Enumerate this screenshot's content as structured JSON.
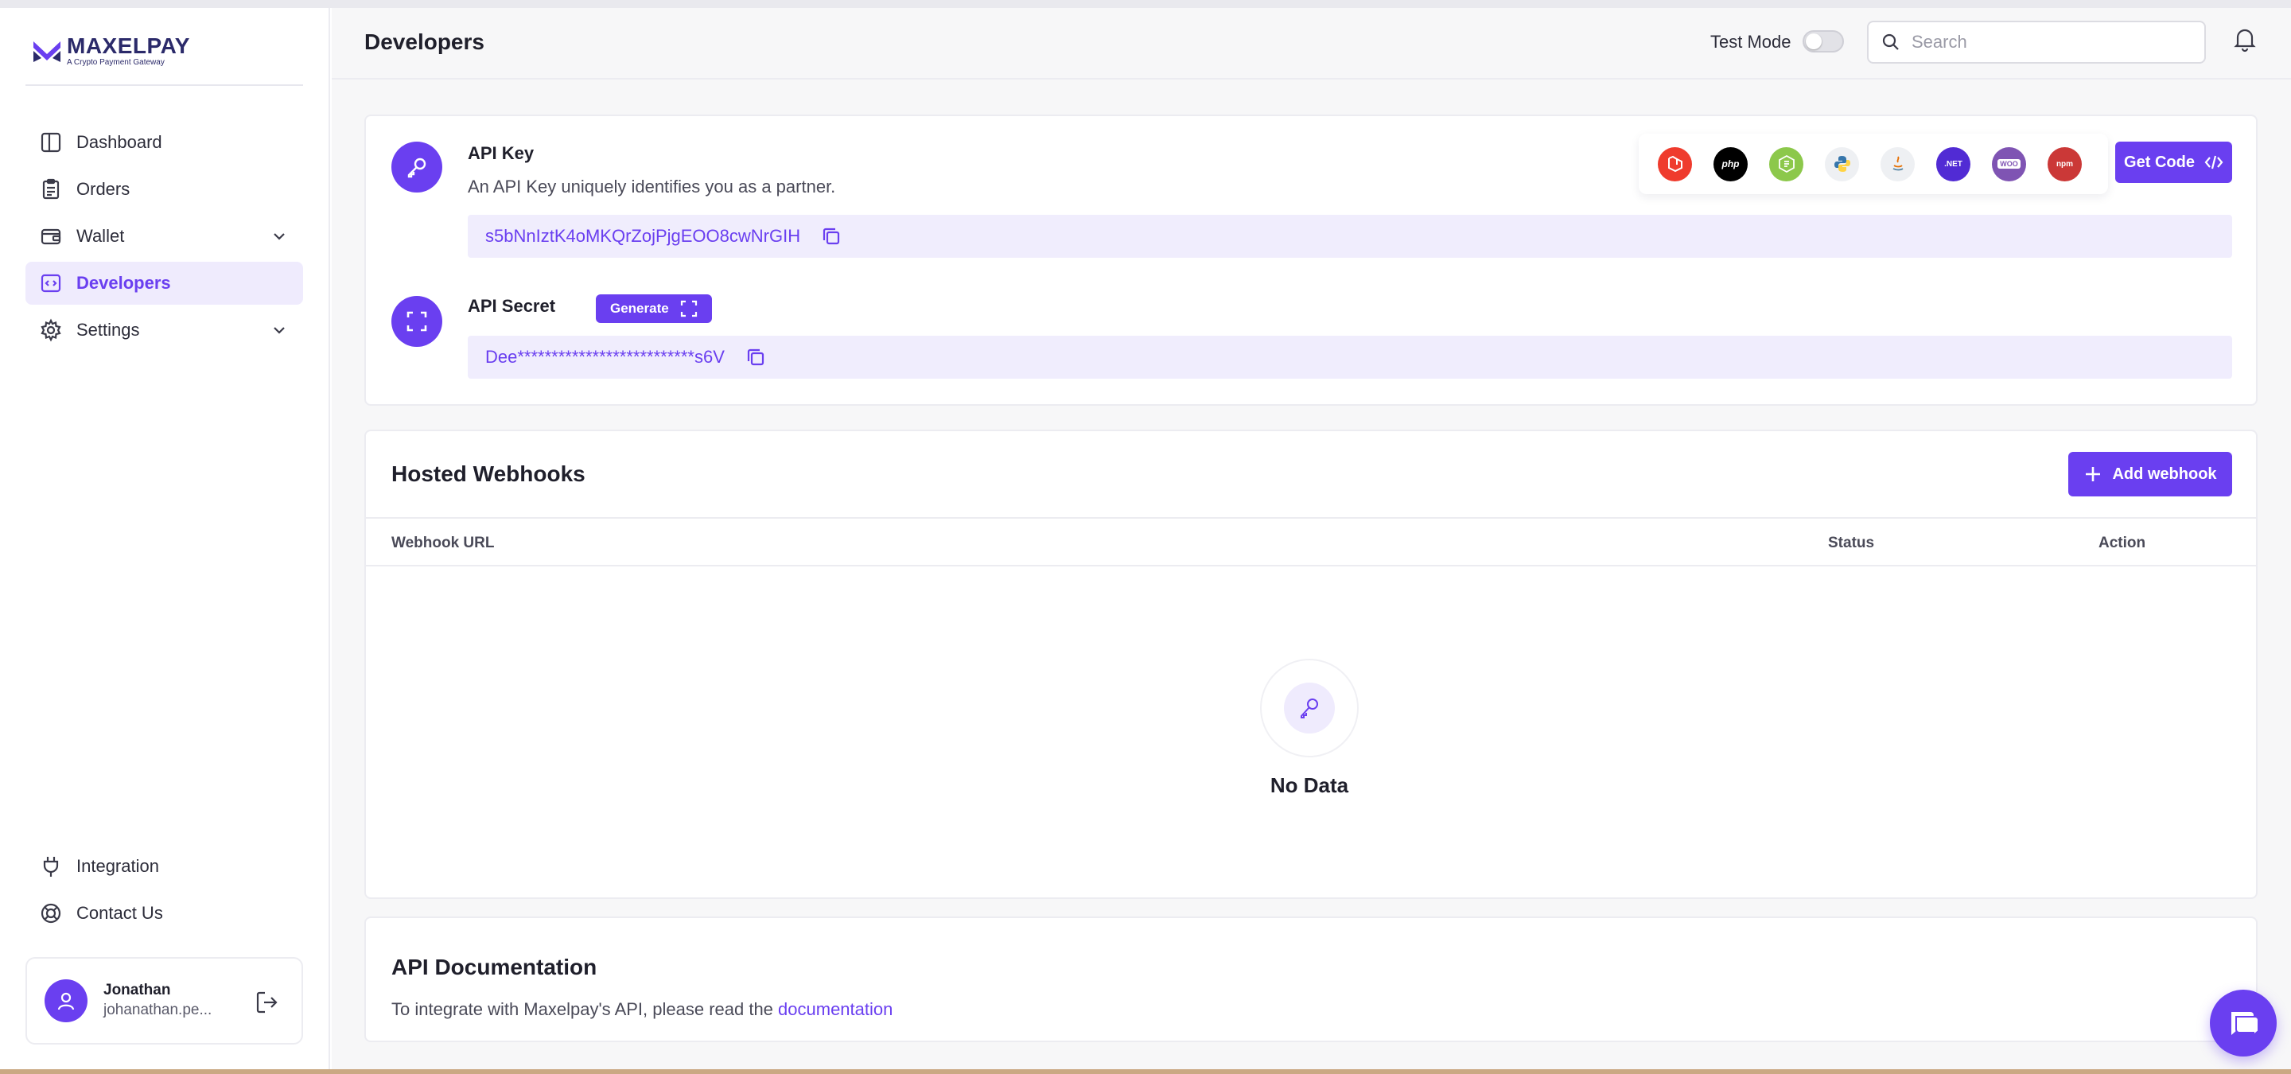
{
  "brand": {
    "name": "MAXELPAY",
    "tagline": "A Crypto Payment Gateway",
    "accent_color": "#6a3ff0"
  },
  "sidebar": {
    "items": [
      {
        "label": "Dashboard",
        "icon": "layout-icon"
      },
      {
        "label": "Orders",
        "icon": "clipboard-icon"
      },
      {
        "label": "Wallet",
        "icon": "wallet-icon",
        "has_submenu": true
      },
      {
        "label": "Developers",
        "icon": "code-icon",
        "active": true
      },
      {
        "label": "Settings",
        "icon": "gear-icon",
        "has_submenu": true
      }
    ],
    "bottom_items": [
      {
        "label": "Integration",
        "icon": "plug-icon"
      },
      {
        "label": "Contact Us",
        "icon": "lifebuoy-icon"
      }
    ],
    "user": {
      "name": "Jonathan",
      "email": "johanathan.pe..."
    }
  },
  "header": {
    "title": "Developers",
    "test_mode_label": "Test Mode",
    "test_mode_on": false,
    "search_placeholder": "Search"
  },
  "api": {
    "key_title": "API Key",
    "key_description": "An API Key uniquely identifies you as a partner.",
    "key_value": "s5bNnIztK4oMKQrZojPjgEOO8cwNrGIH",
    "secret_title": "API Secret",
    "generate_label": "Generate",
    "secret_value": "Dee**************************s6V",
    "get_code_label": "Get Code",
    "languages": [
      {
        "name": "laravel-icon",
        "color": "#ef3b2d",
        "text": ""
      },
      {
        "name": "php-icon",
        "color": "#000000",
        "text": "php"
      },
      {
        "name": "nodejs-icon",
        "color": "#8cc84b",
        "text": ""
      },
      {
        "name": "python-icon",
        "color": "#eef0f3",
        "text": ""
      },
      {
        "name": "java-icon",
        "color": "#eef0f3",
        "text": ""
      },
      {
        "name": "dotnet-icon",
        "color": "#512bd4",
        "text": ".NET"
      },
      {
        "name": "woocommerce-icon",
        "color": "#7f54b3",
        "text": "WOO"
      },
      {
        "name": "npm-icon",
        "color": "#cb3837",
        "text": "npm"
      }
    ]
  },
  "webhooks": {
    "title": "Hosted Webhooks",
    "add_label": "Add webhook",
    "columns": [
      "Webhook URL",
      "Status",
      "Action"
    ],
    "empty_text": "No Data"
  },
  "docs": {
    "title": "API Documentation",
    "text": "To integrate with Maxelpay's API, please read the ",
    "link": "documentation"
  }
}
